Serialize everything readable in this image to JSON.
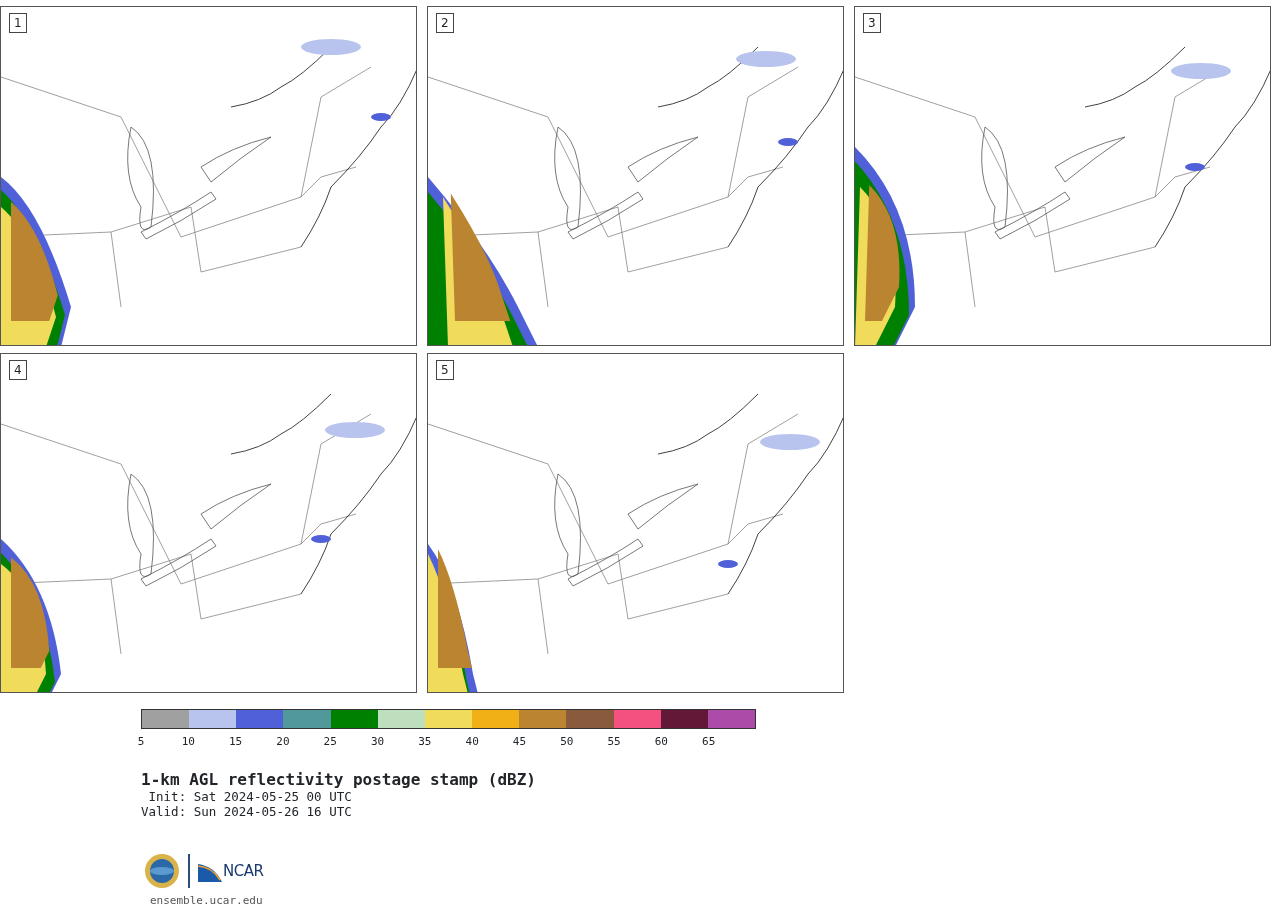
{
  "panels": [
    {
      "label": "1"
    },
    {
      "label": "2"
    },
    {
      "label": "3"
    },
    {
      "label": "4"
    },
    {
      "label": "5"
    }
  ],
  "colorbar": {
    "bins": [
      {
        "color": "#a0a0a0"
      },
      {
        "color": "#b8c4ee"
      },
      {
        "color": "#5060d8"
      },
      {
        "color": "#50989a"
      },
      {
        "color": "#008000"
      },
      {
        "color": "#bedfbe"
      },
      {
        "color": "#f0dc5a"
      },
      {
        "color": "#f0b016"
      },
      {
        "color": "#ba8430"
      },
      {
        "color": "#8a5a3c"
      },
      {
        "color": "#f45080"
      },
      {
        "color": "#641838"
      },
      {
        "color": "#ac4ca8"
      }
    ],
    "ticks": [
      "5",
      "10",
      "15",
      "20",
      "25",
      "30",
      "35",
      "40",
      "45",
      "50",
      "55",
      "60",
      "65"
    ]
  },
  "title": "1-km AGL reflectivity postage stamp (dBZ)",
  "init": " Init: Sat 2024-05-25 00 UTC",
  "valid": "Valid: Sun 2024-05-26 16 UTC",
  "logo": {
    "text": "NCAR"
  },
  "footer": "ensemble.ucar.edu"
}
